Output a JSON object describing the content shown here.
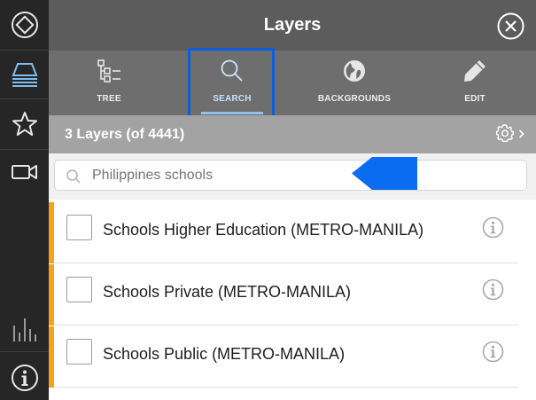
{
  "panel": {
    "title": "Layers",
    "tabs": [
      {
        "label": "TREE",
        "icon": "tree-icon"
      },
      {
        "label": "SEARCH",
        "icon": "search-icon",
        "selected": true
      },
      {
        "label": "BACKGROUNDS",
        "icon": "globe-icon"
      },
      {
        "label": "EDIT",
        "icon": "pencil-icon"
      }
    ],
    "count_text": "3 Layers (of 4441)",
    "search": {
      "value": "",
      "placeholder": "Philippines schools"
    },
    "layers": [
      {
        "label": "Schools Higher Education (METRO-MANILA)",
        "checked": false
      },
      {
        "label": "Schools Private (METRO-MANILA)",
        "checked": false
      },
      {
        "label": "Schools Public (METRO-MANILA)",
        "checked": false
      }
    ]
  },
  "rail": {
    "items": [
      "home-diamond-icon",
      "layers-icon",
      "star-icon",
      "video-camera-icon",
      "chart-bars-icon",
      "info-icon"
    ],
    "active": "layers-icon"
  },
  "colors": {
    "titlebar": "#5c5c5c",
    "tabbar": "#6e6e6e",
    "countbar": "#a3a3a3",
    "rail": "#262626",
    "row_accent": "#f5a21b",
    "highlight_box": "#0a5ddd",
    "pointer_arrow": "#0a6cf0",
    "selected_tab": "#8ec2ef"
  }
}
